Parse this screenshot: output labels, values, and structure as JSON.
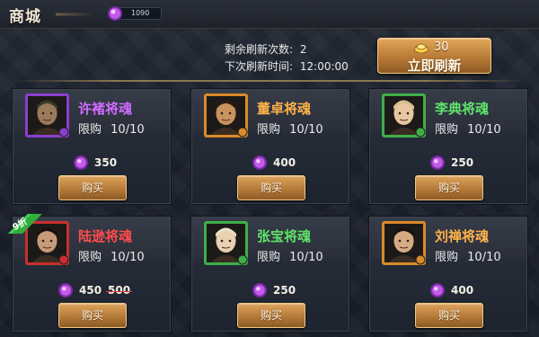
{
  "header": {
    "title": "商城",
    "currency_value": "1090"
  },
  "refresh": {
    "remaining_label": "剩余刷新次数:",
    "remaining_value": "2",
    "next_label": "下次刷新时间:",
    "next_value": "12:00:00",
    "button_cost": "30",
    "button_label": "立即刷新"
  },
  "items": [
    {
      "name": "许褚将魂",
      "name_color": "#d06cff",
      "frame": "purple",
      "limit_label": "限购",
      "limit_value": "10/10",
      "price": "350",
      "buy_label": "购买"
    },
    {
      "name": "董卓将魂",
      "name_color": "#ffb24a",
      "frame": "orange",
      "limit_label": "限购",
      "limit_value": "10/10",
      "price": "400",
      "buy_label": "购买"
    },
    {
      "name": "李典将魂",
      "name_color": "#5fe36a",
      "frame": "green",
      "limit_label": "限购",
      "limit_value": "10/10",
      "price": "250",
      "buy_label": "购买"
    },
    {
      "name": "陆逊将魂",
      "name_color": "#ff4b4b",
      "frame": "red",
      "limit_label": "限购",
      "limit_value": "10/10",
      "price": "450",
      "old_price": "500",
      "discount": "9折",
      "buy_label": "购买"
    },
    {
      "name": "张宝将魂",
      "name_color": "#5fe36a",
      "frame": "green",
      "limit_label": "限购",
      "limit_value": "10/10",
      "price": "250",
      "buy_label": "购买"
    },
    {
      "name": "刘禅将魂",
      "name_color": "#ffb24a",
      "frame": "orange",
      "limit_label": "限购",
      "limit_value": "10/10",
      "price": "400",
      "buy_label": "购买"
    }
  ],
  "colors": {
    "purple": "#8a3fd0",
    "orange": "#d98a2a",
    "green": "#3fae48",
    "red": "#c92f2f",
    "gem": "#c45be8",
    "button_gold": "#b87a36"
  }
}
